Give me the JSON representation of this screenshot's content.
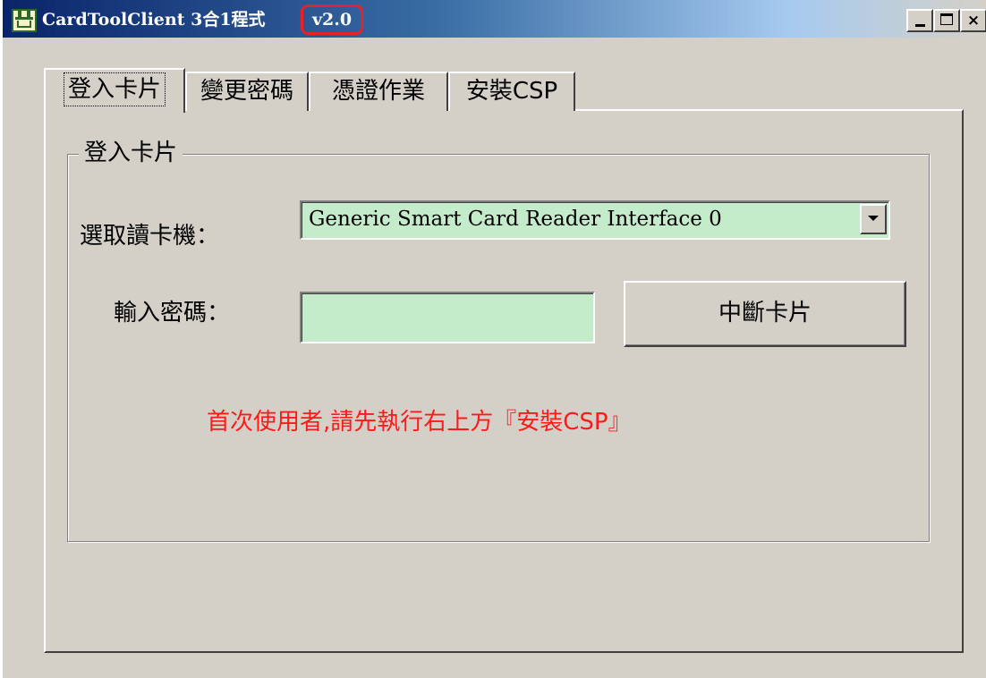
{
  "window": {
    "title": "CardToolClient 3合1程式",
    "version": "v2.0",
    "controls": {
      "minimize": "_",
      "maximize": "□",
      "close": "×"
    }
  },
  "tabs": [
    {
      "label": "登入卡片",
      "selected": true
    },
    {
      "label": "變更密碼",
      "selected": false
    },
    {
      "label": "憑證作業",
      "selected": false
    },
    {
      "label": "安裝CSP",
      "selected": false
    }
  ],
  "login_group": {
    "title": "登入卡片",
    "reader_label": "選取讀卡機：",
    "reader_value": "Generic Smart Card Reader Interface 0",
    "password_label": "輸入密碼：",
    "password_value": "",
    "disconnect_button": "中斷卡片",
    "hint": "首次使用者,請先執行右上方『安裝CSP』"
  },
  "colors": {
    "input_background": "#c4ecca",
    "hint_text": "#ff1a1a",
    "version_highlight": "#e8202a",
    "title_bar": "#0a246a"
  }
}
